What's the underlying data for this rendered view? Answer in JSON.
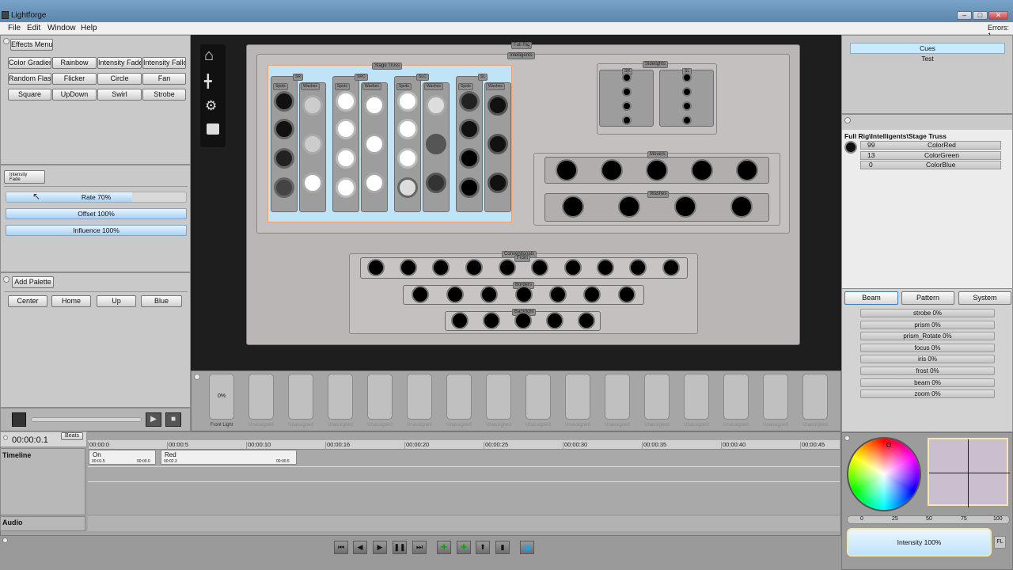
{
  "window": {
    "title": "Lightforge",
    "errors": "Errors: 1",
    "min": "–",
    "max": "□",
    "close": "✕"
  },
  "menu": [
    "File",
    "Edit",
    "Window",
    "Help"
  ],
  "effects": {
    "menu_label": "Effects Menu",
    "buttons": [
      "Color Gradient",
      "Rainbow",
      "Intensity Fade",
      "Intensity Falloff",
      "Random Flash",
      "Flicker",
      "Circle",
      "Fan",
      "Square",
      "UpDown",
      "Swirl",
      "Strobe"
    ],
    "selected": "Intensity\nFade"
  },
  "params": {
    "rate": "Rate 70%",
    "rate_value": 0.7,
    "offset": "Offset 100%",
    "influence": "Influence 100%"
  },
  "palette": {
    "add_label": "Add Palette",
    "buttons": [
      "Center",
      "Home",
      "Up",
      "Blue"
    ]
  },
  "playback": {
    "time": "00:00:0.1",
    "beats": "Beats"
  },
  "timeline": {
    "label": "Timeline",
    "audio": "Audio",
    "ticks": [
      "00:00:0",
      "00:00:5",
      "00:00:10",
      "00:00:16",
      "00:00:20",
      "00:00:25",
      "00:00:30",
      "00:00:35",
      "00:00:40",
      "00:00:45"
    ],
    "clips": [
      {
        "name": "On",
        "a": "00:01.5",
        "b": "00:00.0"
      },
      {
        "name": "Red",
        "a": "00:02.3",
        "b": "00:00.5"
      }
    ]
  },
  "stage": {
    "full_rig": "Full Rig",
    "intelligents": "Intelligents",
    "stage_truss": "Stage Truss",
    "sidelights": "Sidelights",
    "group_labels": [
      "SR",
      "SRC",
      "SLC",
      "SL"
    ],
    "spots": "Spots",
    "washes": "Washes",
    "movers": "Movers",
    "foots": "Foots",
    "conventionals": "Conventionals",
    "front": "Front",
    "borders": "Borders",
    "backlight": "Backlight",
    "sr_side": "SR",
    "sl_side": "SL"
  },
  "faders": {
    "first_value": "0%",
    "first_label": "Front Light",
    "unassigned": "Unassigned"
  },
  "cues": {
    "items": [
      "Cues",
      "Test"
    ]
  },
  "fixture_info": {
    "path": "Full Rig\\Intelligents\\Stage Truss",
    "channels": [
      {
        "value": "99",
        "name": "ColorRed"
      },
      {
        "value": "13",
        "name": "ColorGreen"
      },
      {
        "value": "0",
        "name": "ColorBlue"
      }
    ]
  },
  "attrs": {
    "tabs": [
      "Beam",
      "Pattern",
      "System"
    ],
    "items": [
      "strobe 0%",
      "prism 0%",
      "prism_Rotate 0%",
      "focus 0%",
      "iris 0%",
      "frost 0%",
      "beam 0%",
      "zoom 0%"
    ]
  },
  "color": {
    "scale": [
      "0",
      "25",
      "50",
      "75",
      "100"
    ],
    "intensity": "Intensity 100%",
    "fl": "FL"
  },
  "tools": {
    "left_icons": [
      "home-icon",
      "align-icon",
      "gear-icon",
      "lock-icon"
    ]
  }
}
